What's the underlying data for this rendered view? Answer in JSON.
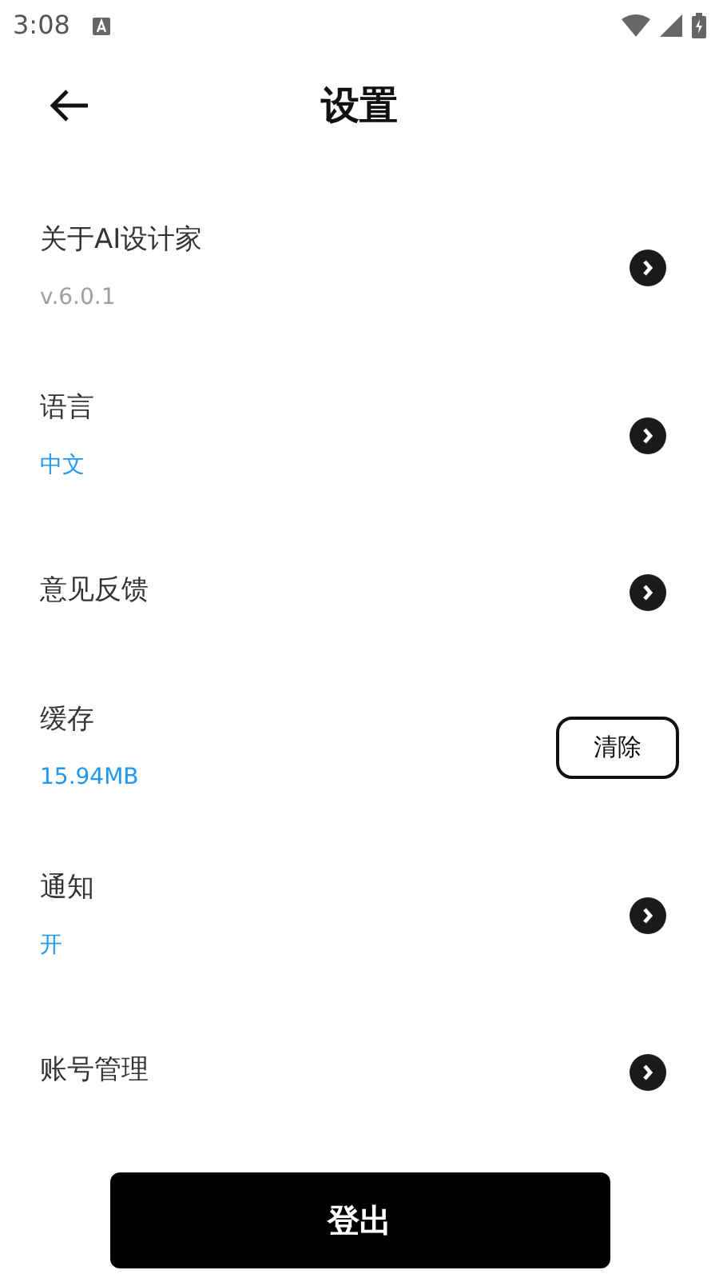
{
  "status_bar": {
    "time": "3:08"
  },
  "header": {
    "title": "设置"
  },
  "items": [
    {
      "kind": "arrow",
      "label": "关于AI设计家",
      "sub": {
        "text": "v.6.0.1",
        "color": "#9e9e9e"
      }
    },
    {
      "kind": "arrow",
      "label": "语言",
      "sub": {
        "text": "中文",
        "color": "#2196f3"
      }
    },
    {
      "kind": "arrow",
      "label": "意见反馈"
    },
    {
      "kind": "button",
      "label": "缓存",
      "sub": {
        "text": "15.94MB",
        "color": "#2196f3"
      },
      "button": "清除"
    },
    {
      "kind": "arrow",
      "label": "通知",
      "sub": {
        "text": "开",
        "color": "#2196f3"
      }
    },
    {
      "kind": "arrow",
      "label": "账号管理"
    }
  ],
  "logout": "登出"
}
